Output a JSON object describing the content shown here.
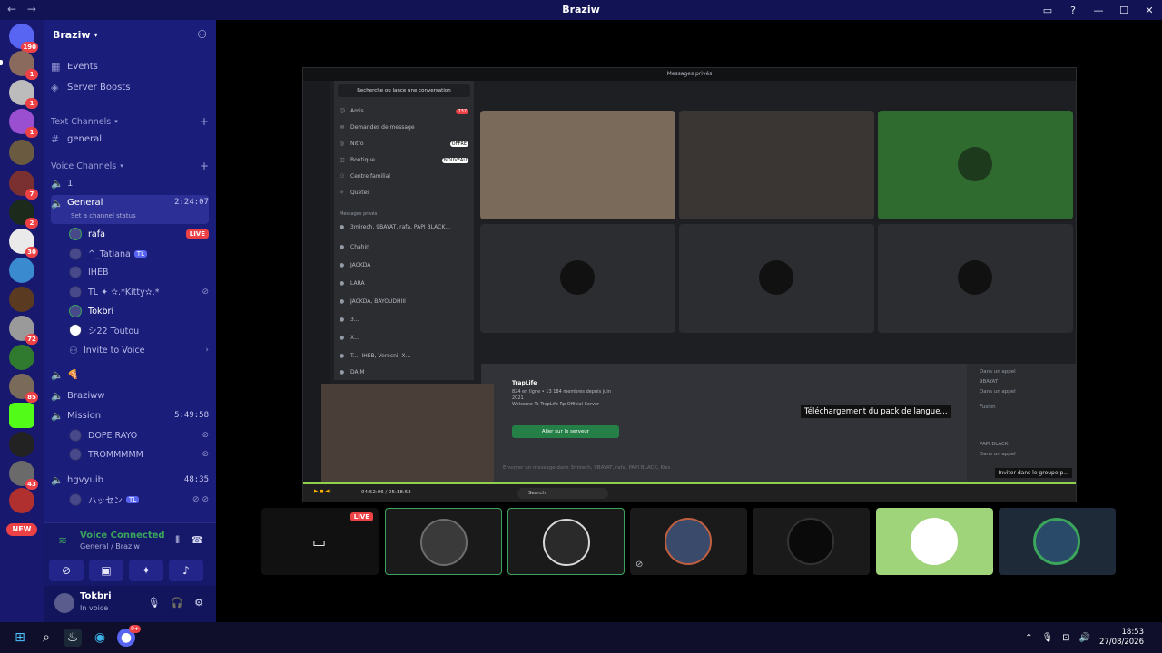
{
  "window": {
    "title": "Braziw",
    "nav": "← →"
  },
  "servers": {
    "home_badge": "190",
    "badges": [
      "1",
      "1",
      "1",
      "",
      "7",
      "2",
      "30",
      "",
      "",
      "72",
      "",
      "",
      "85",
      "",
      "",
      "43"
    ],
    "new_label": "NEW"
  },
  "guild": {
    "name": "Braziw"
  },
  "sidebar": {
    "events": "Events",
    "boosts": "Server Boosts",
    "text_cat": "Text Channels",
    "general_text": "general",
    "voice_cat": "Voice Channels",
    "ch1": "1",
    "general_voice": "General",
    "general_time": "2:24:07",
    "channel_status": "Set a channel status",
    "users": [
      {
        "name": "rafa",
        "extra": "LIVE"
      },
      {
        "name": "^_Tatiana",
        "extra": "TL"
      },
      {
        "name": "IHEB",
        "extra": ""
      },
      {
        "name": "TL ✦ ✫.*Kitty✫.*",
        "extra": ""
      },
      {
        "name": "Tokbri",
        "extra": ""
      },
      {
        "name": "シ22 Toutou",
        "extra": ""
      }
    ],
    "invite": "Invite to Voice",
    "emoji_ch": "🍕",
    "braziww": "Braziww",
    "mission": "Mission",
    "mission_time": "5:49:58",
    "mission_users": [
      "DOPE RAYO",
      "TROMMMMM"
    ],
    "hgvyuib": "hgvyuib",
    "hgvyuib_time": "48:35",
    "hgvyuib_user": "ハッセン"
  },
  "voice": {
    "status": "Voice Connected",
    "channel": "General / Braziw",
    "user": "Tokbri",
    "user_status": "In voice"
  },
  "shared": {
    "title": "Messages privés",
    "search": "Recherche ou lance une conversation",
    "items": [
      {
        "label": "Amis",
        "pill": "737"
      },
      {
        "label": "Demandes de message",
        "pill": ""
      },
      {
        "label": "Nitro",
        "pill": "OFFRE"
      },
      {
        "label": "Boutique",
        "pill": "NOUVEAU"
      },
      {
        "label": "Centre familial",
        "pill": ""
      },
      {
        "label": "Quêtes",
        "pill": ""
      }
    ],
    "dm_header": "Messages privés",
    "dms": [
      "3mirech, 9BAYAT, rafa, PAPI BLACK...",
      "Chahin",
      "JACKDA",
      "LARA",
      "JACKDA, BAYOUDHIII",
      "3...",
      "X...",
      "T..., IHEB, Verocni, X...",
      "DAIM"
    ],
    "toast": "Téléchargement du pack de langue...",
    "server_name": "TrapLife",
    "server_stats": "824 en ligne • 13 184 membres depuis juin 2021",
    "welcome": "Welcome To TrapLife Rp Official Server",
    "join_btn": "Aller sur le serveur",
    "input": "Envoyer un message dans 3mirech, 9BAYAT, rafa, PAPI BLACK, Kiss",
    "invite_group": "Inviter dans le groupe p...",
    "members": [
      "Dans un appel",
      "9BAYAT",
      "Dans un appel",
      "Fusion",
      "PAPI BLACK",
      "Dans un appel"
    ],
    "time_left": "04:52:06 / 05:18:53",
    "search_tb": "Search"
  },
  "tiles": {
    "live": "LIVE"
  },
  "taskbar": {
    "time": "18:53",
    "date": "27/08/2026",
    "discord_badge": "9+"
  }
}
